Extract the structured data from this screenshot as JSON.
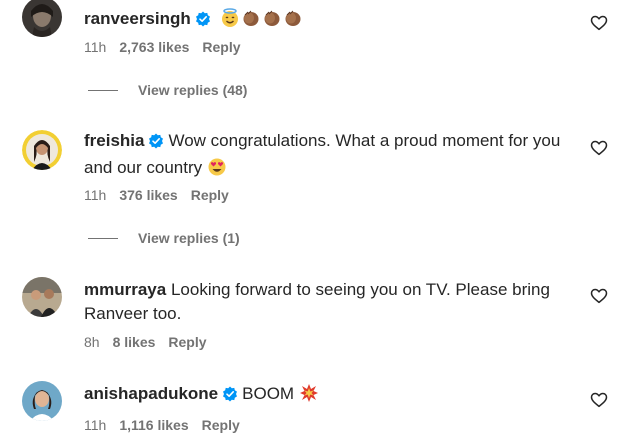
{
  "comments": [
    {
      "username": "ranveersingh",
      "text": "",
      "emojis": [
        "smiling-face-with-halo",
        "clapping-hands-medium-dark",
        "clapping-hands-medium-dark",
        "clapping-hands-medium-dark"
      ],
      "time": "11h",
      "likes": "2,763 likes",
      "reply": "Reply",
      "view_replies": "View replies (48)"
    },
    {
      "username": "freishia",
      "text": "Wow congratulations. What a proud moment for you and our country",
      "emojis": [
        "smiling-face-with-heart-eyes"
      ],
      "time": "11h",
      "likes": "376 likes",
      "reply": "Reply",
      "view_replies": "View replies (1)"
    },
    {
      "username": "mmurraya",
      "text": "Looking forward to seeing you on TV. Please bring Ranveer too.",
      "emojis": [],
      "time": "8h",
      "likes": "8 likes",
      "reply": "Reply"
    },
    {
      "username": "anishapadukone",
      "text": "BOOM",
      "emojis": [
        "collision"
      ],
      "time": "11h",
      "likes": "1,116 likes",
      "reply": "Reply"
    }
  ],
  "colors": {
    "text": "#262626",
    "secondary": "#737373",
    "verified": "#0095f6"
  }
}
